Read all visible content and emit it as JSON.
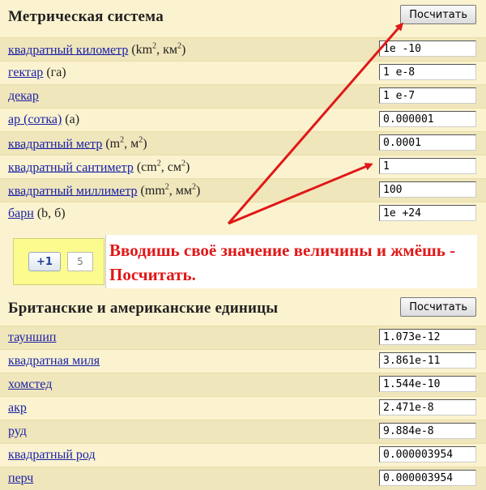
{
  "metric": {
    "title": "Метрическая система",
    "button": "Посчитать",
    "rows": [
      {
        "link": "квадратный километр",
        "sym_a": " (km",
        "sup_a": "2",
        "sym_b": ", км",
        "sup_b": "2",
        "sym_c": ")",
        "value": "1e -10"
      },
      {
        "link": "гектар",
        "sym": " (га)",
        "value": "1 e-8"
      },
      {
        "link": "декар",
        "sym": "",
        "value": "1 e-7"
      },
      {
        "link": "ар (сотка)",
        "sym": " (а)",
        "value": "0.000001"
      },
      {
        "link": "квадратный метр",
        "sym_a": " (m",
        "sup_a": "2",
        "sym_b": ", м",
        "sup_b": "2",
        "sym_c": ")",
        "value": "0.0001"
      },
      {
        "link": "квадратный сантиметр",
        "sym_a": " (cm",
        "sup_a": "2",
        "sym_b": ", см",
        "sup_b": "2",
        "sym_c": ")",
        "value": "1"
      },
      {
        "link": "квадратный миллиметр",
        "sym_a": " (mm",
        "sup_a": "2",
        "sym_b": ", мм",
        "sup_b": "2",
        "sym_c": ")",
        "value": "100"
      },
      {
        "link": "барн",
        "sym": " (b, б)",
        "value": "1e +24"
      }
    ]
  },
  "banner": {
    "plus_label": "+1",
    "plus_count": "5",
    "callout": "Вводишь своё значение величины и жмёшь - Посчитать.",
    "accent_color": "#e01818"
  },
  "imperial": {
    "title": "Британские и американские единицы",
    "button": "Посчитать",
    "rows": [
      {
        "link": "тауншип",
        "value": "1.073e-12"
      },
      {
        "link": "квадратная миля",
        "value": "3.861e-11"
      },
      {
        "link": "хомстед",
        "value": "1.544e-10"
      },
      {
        "link": "акр",
        "value": "2.471e-8"
      },
      {
        "link": "руд",
        "value": "9.884e-8"
      },
      {
        "link": "квадратный род",
        "value": "0.000003954"
      },
      {
        "link": "перч",
        "value": "0.000003954"
      }
    ]
  }
}
